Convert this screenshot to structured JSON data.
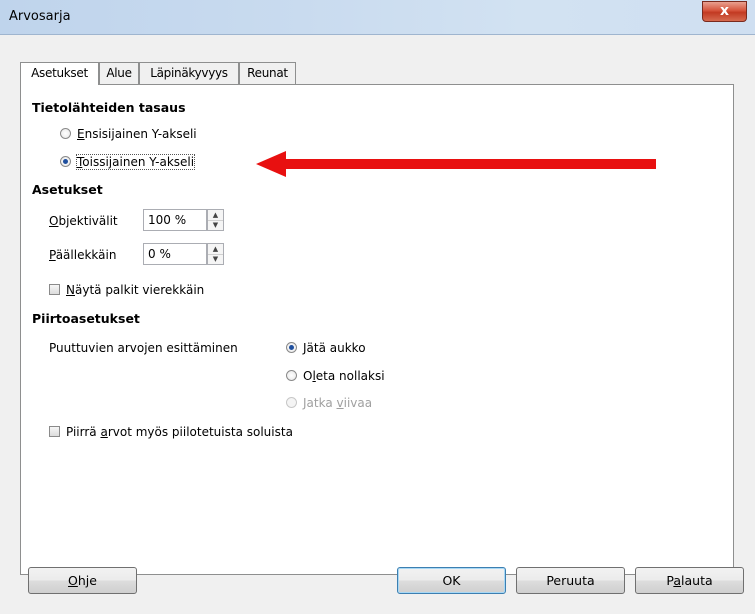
{
  "window": {
    "title": "Arvosarja",
    "close_glyph": "x"
  },
  "tabs": [
    {
      "label": "Asetukset",
      "active": true
    },
    {
      "label": "Alue",
      "active": false
    },
    {
      "label": "Läpinäkyvyys",
      "active": false
    },
    {
      "label": "Reunat",
      "active": false
    }
  ],
  "align": {
    "heading": "Tietolähteiden tasaus",
    "primary": {
      "mn": "E",
      "rest": "nsisijainen Y-akseli",
      "checked": false
    },
    "secondary": {
      "mn": "T",
      "rest": "oissijainen Y-akseli",
      "checked": true
    }
  },
  "settings": {
    "heading": "Asetukset",
    "spacing": {
      "mn": "O",
      "rest": "bjektivälit",
      "value": "100 %"
    },
    "overlap": {
      "mn": "P",
      "rest": "äällekkäin",
      "value": "0 %"
    },
    "side_by_side": {
      "mn": "N",
      "rest": "äytä palkit vierekkäin",
      "checked": false
    }
  },
  "plot": {
    "heading": "Piirtoasetukset",
    "missing_label": "Puuttuvien arvojen esittäminen",
    "leave_gap": {
      "mn": "J",
      "rest": "ätä aukko",
      "checked": true
    },
    "assume_zero": {
      "pre": "O",
      "mn": "l",
      "rest": "eta nollaksi",
      "checked": false
    },
    "continue_line": {
      "pre": "Jatka ",
      "mn": "v",
      "rest": "iivaa",
      "disabled": true
    },
    "hidden_cells": {
      "pre": "Piirrä ",
      "mn": "a",
      "rest": "rvot myös piilotetuista soluista",
      "checked": false
    }
  },
  "buttons": {
    "help": {
      "mn": "O",
      "rest": "hje"
    },
    "ok": "OK",
    "cancel": "Peruuta",
    "reset": {
      "pre": "P",
      "mn": "a",
      "rest": "lauta"
    }
  },
  "annotation": {
    "arrow_color": "#e81010"
  }
}
